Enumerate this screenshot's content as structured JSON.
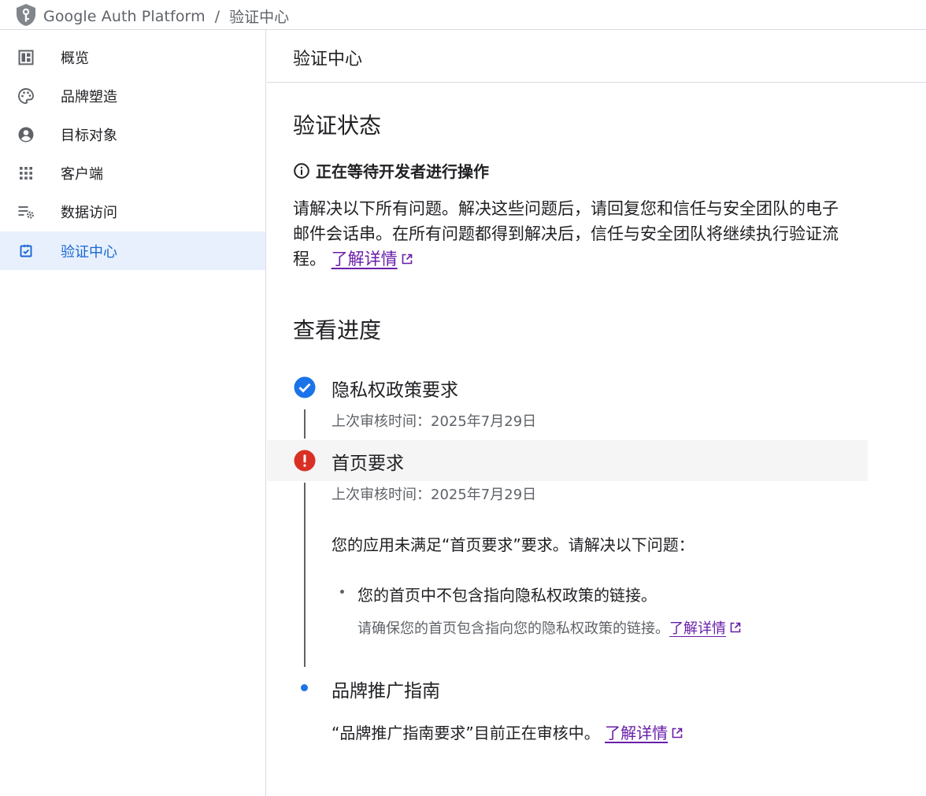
{
  "colors": {
    "accent_blue": "#1a73e8",
    "active_bg": "#e8f0fe",
    "error_red": "#d93025",
    "link_purple": "#681da8"
  },
  "topbar": {
    "logo_icon": "shield-key-icon",
    "app_name": "Google Auth Platform",
    "separator": "/",
    "current_page": "验证中心"
  },
  "sidebar": {
    "items": [
      {
        "label": "概览",
        "icon": "dashboard-icon",
        "active": false
      },
      {
        "label": "品牌塑造",
        "icon": "palette-icon",
        "active": false
      },
      {
        "label": "目标对象",
        "icon": "account-circle-icon",
        "active": false
      },
      {
        "label": "客户端",
        "icon": "grid-icon",
        "active": false
      },
      {
        "label": "数据访问",
        "icon": "list-settings-icon",
        "active": false
      },
      {
        "label": "验证中心",
        "icon": "checkbox-icon",
        "active": true
      }
    ]
  },
  "main": {
    "header_title": "验证中心",
    "verification_status": {
      "title": "验证状态",
      "status_icon": "info-icon",
      "status_text": "正在等待开发者进行操作",
      "description": "请解决以下所有问题。解决这些问题后，请回复您和信任与安全团队的电子邮件会话串。在所有问题都得到解决后，信任与安全团队将继续执行验证流程。",
      "learn_more": "了解详情"
    },
    "progress": {
      "title": "查看进度",
      "steps": [
        {
          "title": "隐私权政策要求",
          "status": "approved",
          "icon": "check-circle-icon",
          "last_review": "上次审核时间：2025年7月29日"
        },
        {
          "title": "首页要求",
          "status": "error",
          "icon": "error-icon",
          "last_review": "上次审核时间：2025年7月29日",
          "message": "您的应用未满足“首页要求”要求。请解决以下问题：",
          "issues": [
            {
              "title": "您的首页中不包含指向隐私权政策的链接。",
              "detail": "请确保您的首页包含指向您的隐私权政策的链接。",
              "learn_more": "了解详情"
            }
          ]
        },
        {
          "title": "品牌推广指南",
          "status": "in_review",
          "icon": "dot-icon",
          "message": "“品牌推广指南要求”目前正在审核中。",
          "learn_more": "了解详情"
        }
      ]
    }
  }
}
